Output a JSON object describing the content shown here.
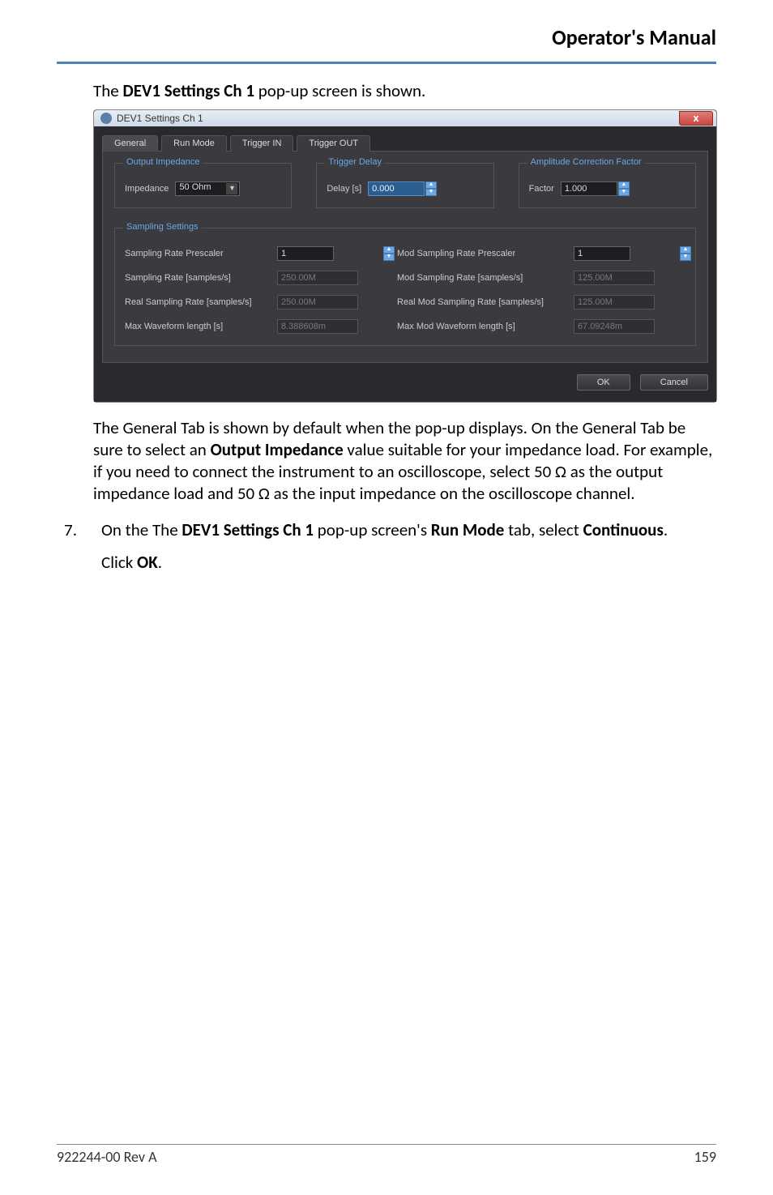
{
  "header": {
    "title": "Operator's Manual"
  },
  "intro": {
    "prefix": "The ",
    "bold": "DEV1 Settings Ch 1",
    "suffix": " pop-up screen is shown."
  },
  "dialog": {
    "title": "DEV1 Settings Ch 1",
    "close_glyph": "x",
    "tabs": {
      "general": "General",
      "run_mode": "Run Mode",
      "trigger_in": "Trigger IN",
      "trigger_out": "Trigger OUT"
    },
    "groups": {
      "output_impedance_legend": "Output Impedance",
      "trigger_delay_legend": "Trigger Delay",
      "amp_corr_legend": "Amplitude Correction Factor",
      "sampling_legend": "Sampling Settings"
    },
    "output_impedance": {
      "label": "Impedance",
      "value": "50 Ohm"
    },
    "trigger_delay": {
      "label": "Delay [s]",
      "value": "0.000"
    },
    "amp_corr": {
      "label": "Factor",
      "value": "1.000"
    },
    "sampling": {
      "rows": [
        {
          "l1": "Sampling Rate Prescaler",
          "v1": "1",
          "v1_editable": true,
          "l2": "Mod Sampling Rate Prescaler",
          "v2": "1",
          "v2_editable": true
        },
        {
          "l1": "Sampling Rate [samples/s]",
          "v1": "250.00M",
          "v1_editable": false,
          "l2": "Mod Sampling Rate [samples/s]",
          "v2": "125.00M",
          "v2_editable": false
        },
        {
          "l1": "Real Sampling Rate [samples/s]",
          "v1": "250.00M",
          "v1_editable": false,
          "l2": "Real Mod Sampling Rate [samples/s]",
          "v2": "125.00M",
          "v2_editable": false
        },
        {
          "l1": "Max Waveform length [s]",
          "v1": "8.388608m",
          "v1_editable": false,
          "l2": "Max Mod Waveform length [s]",
          "v2": "67.09248m",
          "v2_editable": false
        }
      ]
    },
    "buttons": {
      "ok": "OK",
      "cancel": "Cancel"
    }
  },
  "body_para": {
    "t1": "The General Tab is shown by default when the pop-up displays. On the General Tab be sure to select an ",
    "b1": "Output Impedance",
    "t2": " value suitable for your impedance load. For example, if you need to connect the instrument to an oscilloscope, select 50 Ω as the output impedance load and 50 Ω as the input impedance on the oscilloscope channel."
  },
  "step7": {
    "num": "7.",
    "t1": "On the The ",
    "b1": "DEV1 Settings Ch 1",
    "t2": " pop-up screen's ",
    "b2": "Run Mode",
    "t3": " tab, select ",
    "b3": "Continuous",
    "t4": ".",
    "click_t1": "Click ",
    "click_b1": "OK",
    "click_t2": "."
  },
  "footer": {
    "doc_id": "922244-00 Rev A",
    "page": "159"
  }
}
